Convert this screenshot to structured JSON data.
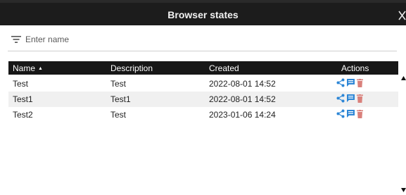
{
  "dialog": {
    "title": "Browser states"
  },
  "filter": {
    "placeholder": "Enter name",
    "icon": "filter-icon"
  },
  "table": {
    "columns": {
      "name": "Name",
      "description": "Description",
      "created": "Created",
      "actions": "Actions"
    },
    "sort": {
      "column": "name",
      "direction": "ascending"
    },
    "rows": [
      {
        "name": "Test",
        "description": "Test",
        "created": "2022-08-01 14:52"
      },
      {
        "name": "Test1",
        "description": "Test1",
        "created": "2022-08-01 14:52"
      },
      {
        "name": "Test2",
        "description": "Test",
        "created": "2023-01-06 14:24"
      }
    ]
  },
  "colors": {
    "header_bg": "#171717",
    "title_bg": "#1c1c1c",
    "action_blue": "#2d86d6",
    "delete_red": "#d9807b"
  },
  "icons": [
    "close-icon",
    "filter-icon",
    "sort-ascending-icon",
    "share-icon",
    "comment-icon",
    "delete-icon",
    "scroll-up-icon",
    "scroll-down-icon"
  ]
}
